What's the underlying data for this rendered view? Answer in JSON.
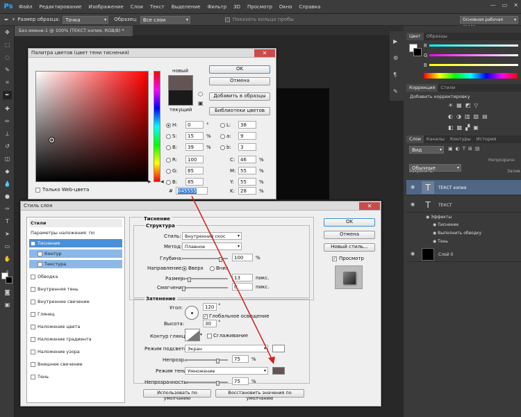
{
  "app": {
    "logo": "Ps",
    "menu": [
      "Файл",
      "Редактирование",
      "Изображение",
      "Слои",
      "Текст",
      "Выделение",
      "Фильтр",
      "3D",
      "Просмотр",
      "Окно",
      "Справка"
    ]
  },
  "options": {
    "sample_size_label": "Размер образца:",
    "sample_size_value": "Точка",
    "sample_label": "Образец:",
    "sample_value": "Все слои",
    "show_ring_label": "Показать кольцо пробы",
    "workspace_label": "Основная рабочая среда"
  },
  "document": {
    "tab": "Без имени-1 @ 100% (ТЕКСТ копия, RGB/8) *"
  },
  "color_panel": {
    "tabs": [
      "Цвет",
      "Образцы"
    ],
    "channels": [
      "R",
      "G",
      "B"
    ]
  },
  "adjust_panel": {
    "tabs": [
      "Коррекция",
      "Стили"
    ],
    "add_label": "Добавить корректировку"
  },
  "layers_panel": {
    "tabs": [
      "Слои",
      "Каналы",
      "Контуры",
      "История"
    ],
    "filter_value": "Вид",
    "blend_mode": "Обычные",
    "opacity_label": "Непрозрачн",
    "lock_label": "Закрепить:",
    "fill_label": "Залив",
    "layers": [
      {
        "name": "ТЕКСТ копия",
        "type": "text"
      },
      {
        "name": "ТЕКСТ",
        "type": "text"
      },
      {
        "name": "Эффекты",
        "type": "effects"
      },
      {
        "name": "Тиснение",
        "type": "effect"
      },
      {
        "name": "Выполнить обводку",
        "type": "effect"
      },
      {
        "name": "Тень",
        "type": "effect"
      },
      {
        "name": "Слой 0",
        "type": "image"
      }
    ]
  },
  "color_picker": {
    "title": "Палитра цветов (цвет тени тиснения)",
    "new_label": "новый",
    "current_label": "текущий",
    "ok": "OK",
    "cancel": "Отмена",
    "add_swatch": "Добавить в образцы",
    "color_libraries": "Библиотеки цветов",
    "web_only": "Только Web-цвета",
    "hsb": [
      {
        "label": "H:",
        "value": "0",
        "unit": "°"
      },
      {
        "label": "S:",
        "value": "15",
        "unit": "%"
      },
      {
        "label": "B:",
        "value": "39",
        "unit": "%"
      }
    ],
    "rgb": [
      {
        "label": "R:",
        "value": "100"
      },
      {
        "label": "G:",
        "value": "85"
      },
      {
        "label": "B:",
        "value": "85"
      }
    ],
    "lab": [
      {
        "label": "L:",
        "value": "38"
      },
      {
        "label": "a:",
        "value": "9"
      },
      {
        "label": "b:",
        "value": "3"
      }
    ],
    "cmyk": [
      {
        "label": "C:",
        "value": "46",
        "unit": "%"
      },
      {
        "label": "M:",
        "value": "55",
        "unit": "%"
      },
      {
        "label": "Y:",
        "value": "55",
        "unit": "%"
      },
      {
        "label": "K:",
        "value": "28",
        "unit": "%"
      }
    ],
    "hex_label": "#",
    "hex_value": "645555",
    "new_color": "#645555",
    "current_color": "#1a1a1a"
  },
  "layer_style": {
    "title": "Стиль слоя",
    "styles_header": "Стили",
    "blending_options": "Параметры наложения: по умолчанию",
    "items": [
      {
        "label": "Тиснение",
        "checked": true,
        "selected": true
      },
      {
        "label": "Контур",
        "checked": false,
        "sub": true
      },
      {
        "label": "Текстура",
        "checked": false,
        "sub": true
      },
      {
        "label": "Обводка",
        "checked": false
      },
      {
        "label": "Внутренняя тень",
        "checked": false
      },
      {
        "label": "Внутреннее свечение",
        "checked": false
      },
      {
        "label": "Глянец",
        "checked": false
      },
      {
        "label": "Наложение цвета",
        "checked": false
      },
      {
        "label": "Наложение градиента",
        "checked": false
      },
      {
        "label": "Наложение узора",
        "checked": false
      },
      {
        "label": "Внешнее свечение",
        "checked": false
      },
      {
        "label": "Тень",
        "checked": false
      }
    ],
    "section": "Тиснение",
    "structure": "Структура",
    "style_label": "Стиль:",
    "style_value": "Внутренний скос",
    "method_label": "Метод:",
    "method_value": "Плавное",
    "depth_label": "Глубина:",
    "depth_value": "100",
    "depth_unit": "%",
    "direction_label": "Направление:",
    "dir_up": "Вверх",
    "dir_down": "Вниз",
    "size_label": "Размер:",
    "size_value": "13",
    "size_unit": "пикс.",
    "soften_label": "Смягчение:",
    "soften_value": "0",
    "soften_unit": "пикс.",
    "shading": "Затенение",
    "angle_label": "Угол:",
    "angle_value": "120",
    "angle_unit": "°",
    "global_light": "Глобальное освещение",
    "altitude_label": "Высота:",
    "altitude_value": "30",
    "altitude_unit": "°",
    "gloss_label": "Контур глянца:",
    "antialias": "Сглаживание",
    "highlight_label": "Режим подсветки:",
    "highlight_value": "Экран",
    "hl_opacity_label": "Непрозр.:",
    "hl_opacity_value": "75",
    "hl_opacity_unit": "%",
    "shadow_label": "Режим тени:",
    "shadow_value": "Умножение",
    "sh_opacity_label": "Непрозрачность:",
    "sh_opacity_value": "75",
    "sh_opacity_unit": "%",
    "make_default": "Использовать по умолчанию",
    "reset_default": "Восстановить значения по умолчанию",
    "ok": "OK",
    "cancel": "Отмена",
    "new_style": "Новый стиль...",
    "preview": "Просмотр",
    "shadow_color": "#645555"
  }
}
